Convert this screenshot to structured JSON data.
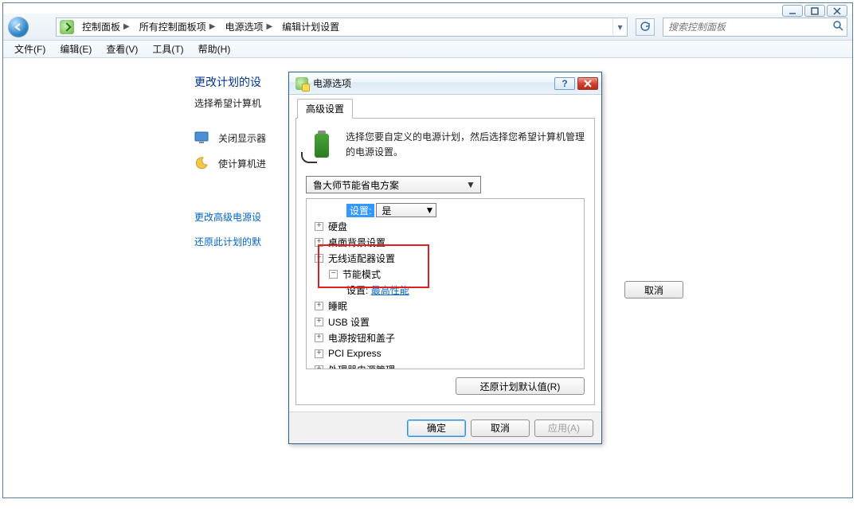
{
  "window": {
    "search_placeholder": "搜索控制面板"
  },
  "breadcrumb": {
    "items": [
      "控制面板",
      "所有控制面板项",
      "电源选项",
      "编辑计划设置"
    ]
  },
  "menubar": {
    "items": [
      "文件(F)",
      "编辑(E)",
      "查看(V)",
      "工具(T)",
      "帮助(H)"
    ]
  },
  "page": {
    "title": "更改计划的设",
    "subtitle": "选择希望计算机",
    "row_display": "关闭显示器",
    "row_sleep": "使计算机进",
    "link_advanced": "更改高级电源设",
    "link_restore": "还原此计划的默",
    "cancel": "取消"
  },
  "dialog": {
    "title": "电源选项",
    "tab": "高级设置",
    "description": "选择您要自定义的电源计划，然后选择您希望计算机管理的电源设置。",
    "plan_selected": "鲁大师节能省电方案",
    "setting_label": "设置:",
    "setting_value": "是",
    "tree": {
      "n0": "硬盘",
      "n1": "桌面背景设置",
      "n2": "无线适配器设置",
      "n2a": "节能模式",
      "n2a_setting_label": "设置:",
      "n2a_setting_value": "最高性能",
      "n3": "睡眠",
      "n4": "USB 设置",
      "n5": "电源按钮和盖子",
      "n6": "PCI Express",
      "n7": "处理器电源管理"
    },
    "restore_defaults": "还原计划默认值(R)",
    "ok": "确定",
    "cancel": "取消",
    "apply": "应用(A)"
  }
}
